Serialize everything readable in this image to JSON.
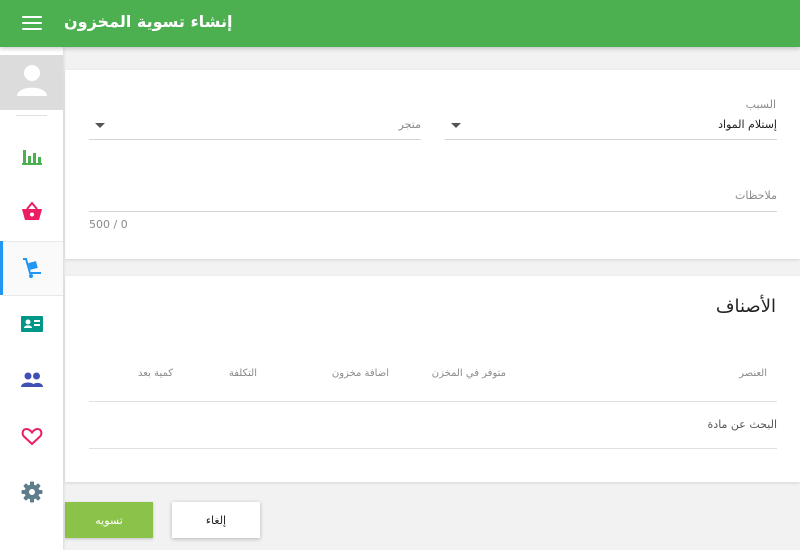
{
  "header": {
    "title": "إنشاء تسوية المخزون",
    "menu_icon": "hamburger-menu-icon",
    "background_color": "#4caf50"
  },
  "sidebar": {
    "avatar_icon": "user-avatar-icon",
    "active_index": 2,
    "active_indicator_color": "#2196f3",
    "items": [
      {
        "icon": "bar-chart-icon",
        "color": "#4caf50"
      },
      {
        "icon": "shopping-basket-icon",
        "color": "#e91e63"
      },
      {
        "icon": "hand-truck-icon",
        "color": "#2196f3"
      },
      {
        "icon": "contact-card-icon",
        "color": "#009688"
      },
      {
        "icon": "people-icon",
        "color": "#3f51b5"
      },
      {
        "icon": "heart-outline-icon",
        "color": "#e91e63"
      },
      {
        "icon": "gear-icon",
        "color": "#607d8b"
      }
    ]
  },
  "form": {
    "reason": {
      "label": "السبب",
      "value": "إستلام المواد"
    },
    "store": {
      "placeholder": "متجر",
      "value": ""
    },
    "notes": {
      "label": "ملاحظات",
      "value": "",
      "counter": "500 / 0"
    }
  },
  "items": {
    "title": "الأصناف",
    "columns": [
      "العنصر",
      "متوفر في المخزن",
      "اضافة مخزون",
      "التكلفة",
      "كمية بعد"
    ],
    "search_placeholder": "البحث عن مادة"
  },
  "actions": {
    "submit_label": "تسويه",
    "submit_color": "#8bc34a",
    "cancel_label": "إلغاء"
  }
}
